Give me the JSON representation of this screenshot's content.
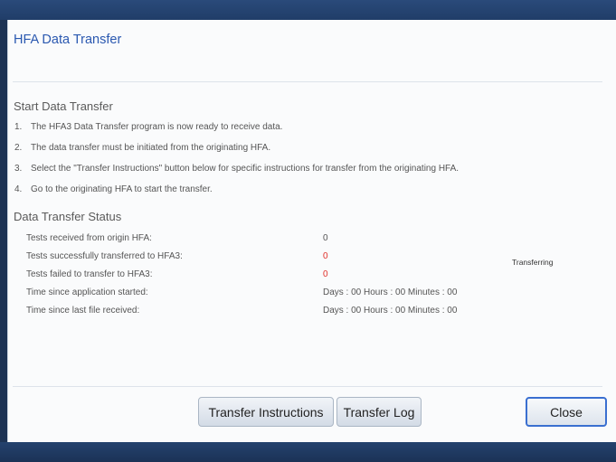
{
  "dialog": {
    "title": "HFA Data Transfer"
  },
  "start_section": {
    "heading": "Start Data Transfer",
    "steps": [
      {
        "num": "1.",
        "text": "The HFA3 Data Transfer program is now ready to receive data."
      },
      {
        "num": "2.",
        "text": "The data transfer must be initiated from the originating HFA."
      },
      {
        "num": "3.",
        "text": "Select the \"Transfer Instructions\" button below for specific instructions for transfer from the originating HFA."
      },
      {
        "num": "4.",
        "text": "Go to the originating HFA to start the transfer."
      }
    ]
  },
  "status_section": {
    "heading": "Data Transfer Status",
    "rows": [
      {
        "label": "Tests received from origin HFA:",
        "value": "0"
      },
      {
        "label": "Tests successfully transferred to HFA3:",
        "value": "0"
      },
      {
        "label": "Tests failed to transfer to HFA3:",
        "value": "0"
      },
      {
        "label": "Time since application started:",
        "value": "Days : 00 Hours : 00 Minutes : 00"
      },
      {
        "label": "Time since last file received:",
        "value": "Days : 00 Hours : 00 Minutes : 00"
      }
    ],
    "status_text": "Transferring"
  },
  "buttons": {
    "instructions": "Transfer Instructions",
    "log": "Transfer Log",
    "close": "Close"
  },
  "colors": {
    "title_blue": "#2a58b0",
    "error_red": "#e0302a",
    "frame_navy": "#1d3354",
    "close_border": "#3a6fd0"
  }
}
